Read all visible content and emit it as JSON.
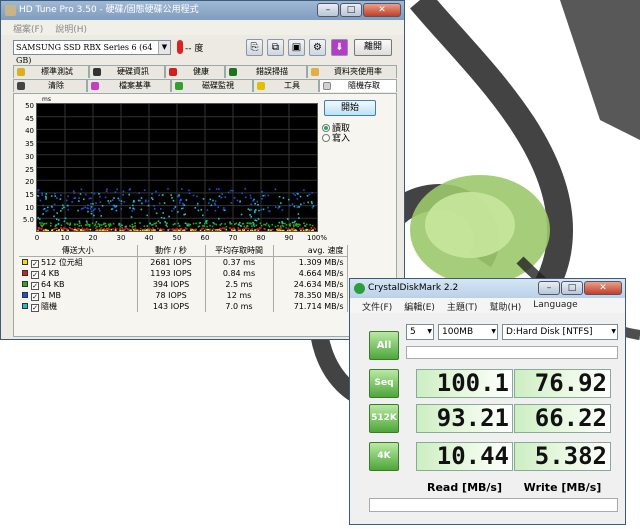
{
  "hdtune": {
    "title": "HD Tune Pro 3.50 - 硬碟/固態硬碟公用程式",
    "menu": [
      "檔案(F)",
      "說明(H)"
    ],
    "drive": "SAMSUNG SSD RBX Series 6 (64 GB)",
    "temperature": "-- 度",
    "exit_label": "離開",
    "tabs_top": [
      "標準測試",
      "硬碟資訊",
      "健康",
      "錯誤掃描",
      "資料夾使用率"
    ],
    "tabs_bottom": [
      "清除",
      "檔案基準",
      "磁碟監視",
      "工具",
      "隨機存取"
    ],
    "active_tab": "隨機存取",
    "start_label": "開始",
    "radio_read": "讀取",
    "radio_write": "寫入",
    "radio_selected": "read",
    "chart_ms_label": "ms",
    "y_ticks": [
      "50",
      "45",
      "40",
      "35",
      "30",
      "25",
      "20",
      "15",
      "10",
      "5.0"
    ],
    "x_ticks": [
      "0",
      "10",
      "20",
      "30",
      "40",
      "50",
      "60",
      "70",
      "80",
      "90",
      "100%"
    ],
    "table_headers": [
      "傳送大小",
      "動作 / 秒",
      "平均存取時間",
      "avg. 速度"
    ],
    "rows": [
      {
        "size": "512 位元組",
        "ops": "2681 IOPS",
        "access": "0.37 ms",
        "speed": "1.309 MB/s",
        "color": "#f0e000"
      },
      {
        "size": "4 KB",
        "ops": "1193 IOPS",
        "access": "0.84 ms",
        "speed": "4.664 MB/s",
        "color": "#d02020"
      },
      {
        "size": "64 KB",
        "ops": "394 IOPS",
        "access": "2.5 ms",
        "speed": "24.634 MB/s",
        "color": "#20b020"
      },
      {
        "size": "1 MB",
        "ops": "78 IOPS",
        "access": "12 ms",
        "speed": "78.350 MB/s",
        "color": "#2050e0"
      },
      {
        "size": "隨機",
        "ops": "143 IOPS",
        "access": "7.0 ms",
        "speed": "71.714 MB/s",
        "color": "#20c0c0"
      }
    ]
  },
  "cdm": {
    "title": "CrystalDiskMark 2.2",
    "menu": [
      "文件(F)",
      "編輯(E)",
      "主題(T)",
      "幫助(H)",
      "Language"
    ],
    "all_label": "All",
    "runs": "5",
    "size": "100MB",
    "drive": "D:Hard Disk [NTFS]",
    "rows": [
      {
        "label": "Seq",
        "read": "100.1",
        "write": "76.92"
      },
      {
        "label": "512K",
        "read": "93.21",
        "write": "66.22"
      },
      {
        "label": "4K",
        "read": "10.44",
        "write": "5.382"
      }
    ],
    "read_header": "Read [MB/s]",
    "write_header": "Write [MB/s]"
  }
}
